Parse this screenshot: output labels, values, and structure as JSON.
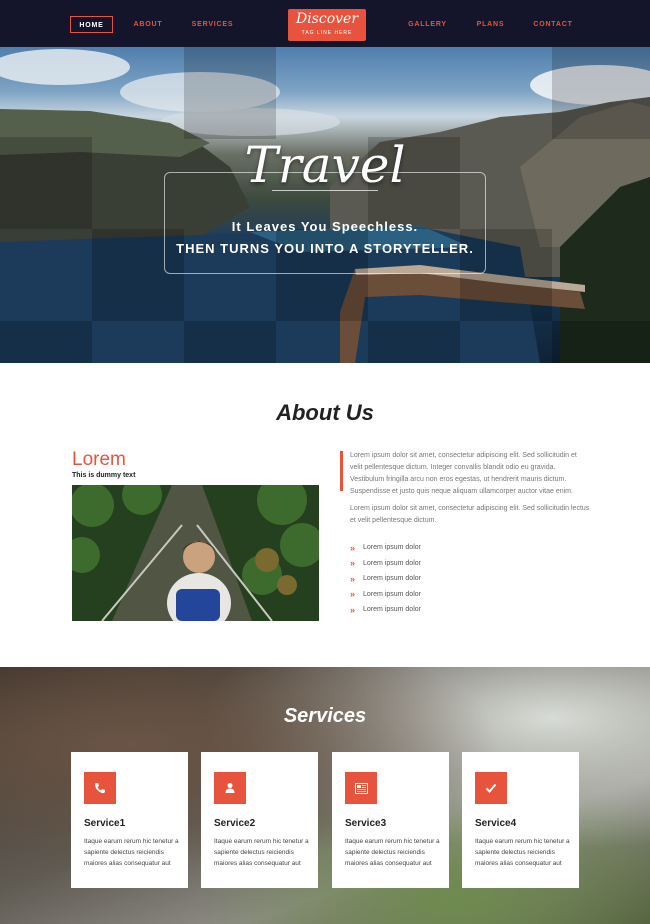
{
  "nav": {
    "items": [
      "HOME",
      "ABOUT",
      "SERVICES",
      "GALLERY",
      "PLANS",
      "CONTACT"
    ],
    "active": "HOME",
    "logo_title": "Discover",
    "logo_tagline": "TAG LINE HERE"
  },
  "hero": {
    "title": "Travel",
    "subtitle_line1": "It Leaves You Speechless.",
    "subtitle_line2": "THEN TURNS YOU INTO A STORYTELLER."
  },
  "about": {
    "heading": "About Us",
    "lorem_title": "Lorem",
    "lorem_subtitle": "This is dummy text",
    "paragraph1": "Lorem ipsum dolor sit amet, consectetur adipiscing elit. Sed sollicitudin et velit pellentesque dictum. Integer convallis blandit odio eu gravida. Vestibulum fringilla arcu non eros egestas, ut hendrerit mauris dictum. Suspendisse et justo quis neque aliquam ullamcorper auctor vitae enim.",
    "paragraph2": "Lorem ipsum dolor sit amet, consectetur adipiscing elit. Sed sollicitudin lectus et velit pellentesque dictum.",
    "list": [
      "Lorem ipsum dolor",
      "Lorem ipsum dolor",
      "Lorem ipsum dolor",
      "Lorem ipsum dolor",
      "Lorem ipsum dolor"
    ]
  },
  "services": {
    "heading": "Services",
    "cards": [
      {
        "title": "Service1",
        "icon": "phone-icon",
        "text": "Itaque earum rerum hic tenetur a sapiente delectus reiciendis maiores alias consequatur aut"
      },
      {
        "title": "Service2",
        "icon": "user-icon",
        "text": "Itaque earum rerum hic tenetur a sapiente delectus reiciendis maiores alias consequatur aut"
      },
      {
        "title": "Service3",
        "icon": "newspaper-icon",
        "text": "Itaque earum rerum hic tenetur a sapiente delectus reiciendis maiores alias consequatur aut"
      },
      {
        "title": "Service4",
        "icon": "check-icon",
        "text": "Itaque earum rerum hic tenetur a sapiente delectus reiciendis maiores alias consequatur aut"
      }
    ]
  },
  "colors": {
    "accent": "#e8533e",
    "nav_background": "#14152a"
  }
}
